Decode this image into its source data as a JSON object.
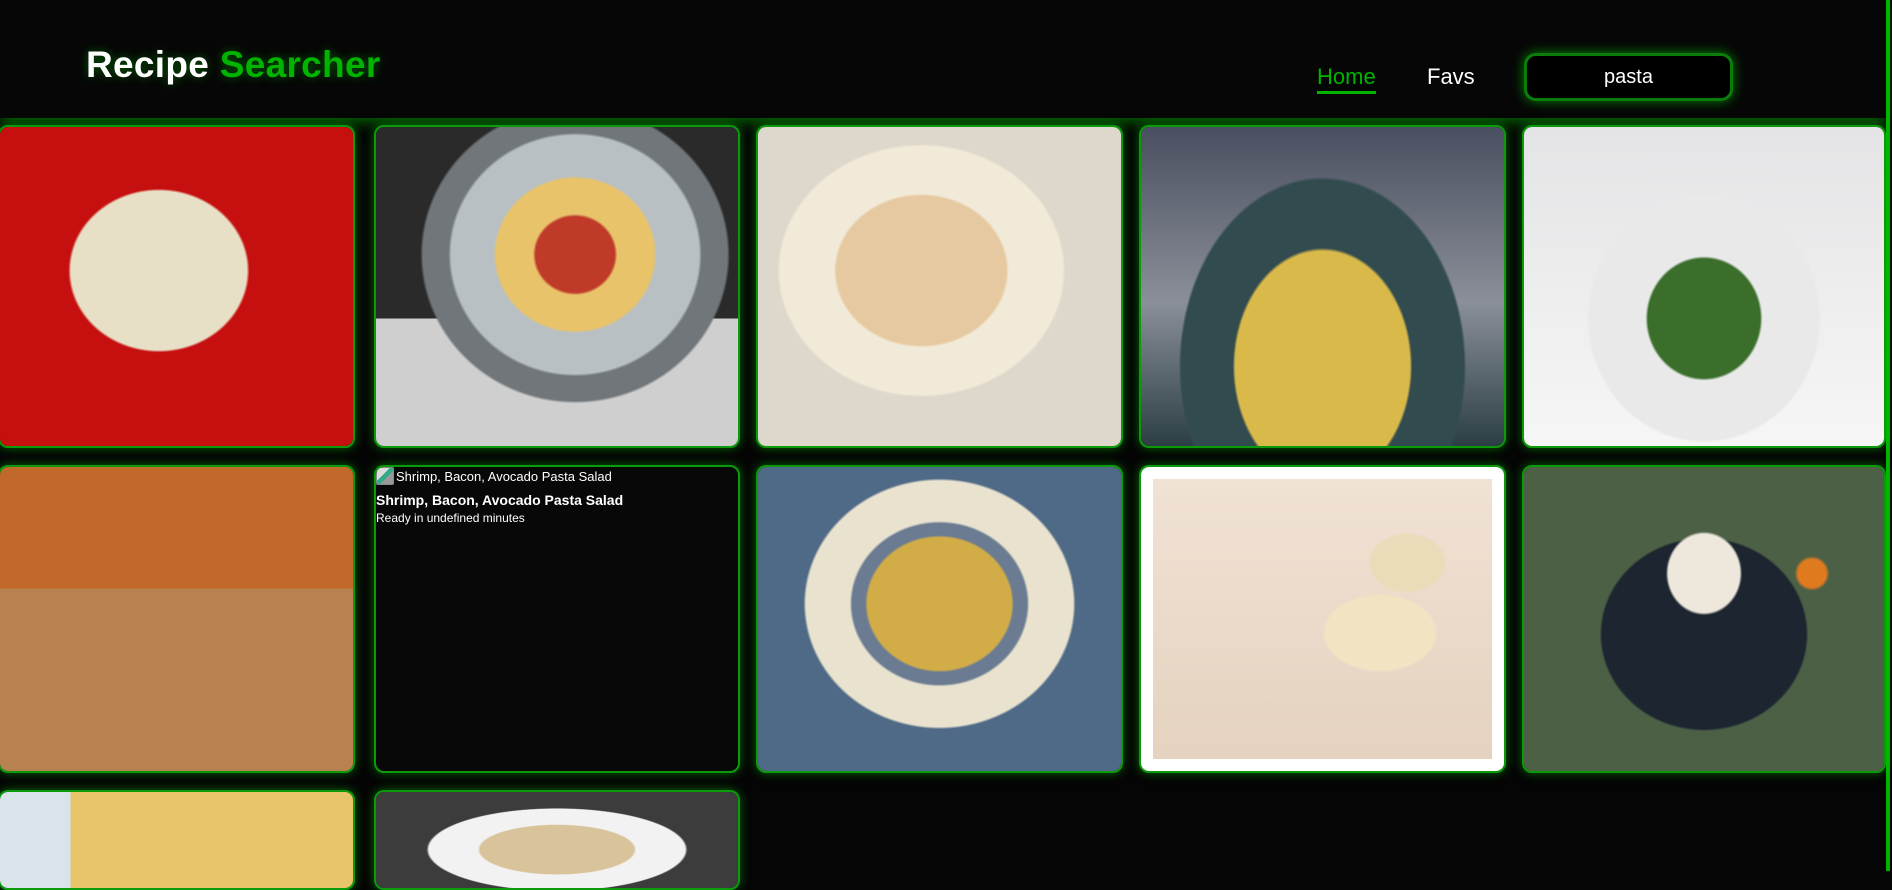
{
  "header": {
    "logo_white": "Recipe",
    "logo_green": "Searcher",
    "nav": {
      "home": "Home",
      "favs": "Favs"
    },
    "search_value": "pasta"
  },
  "colors": {
    "accent": "#00b400",
    "background": "#050505"
  },
  "cards": [
    {
      "kind": "image",
      "icon": "pasta-photo"
    },
    {
      "kind": "image",
      "icon": "pasta-photo"
    },
    {
      "kind": "image",
      "icon": "pasta-photo"
    },
    {
      "kind": "image",
      "icon": "pasta-photo"
    },
    {
      "kind": "image",
      "icon": "pasta-photo"
    },
    {
      "kind": "image",
      "icon": "pasta-photo"
    },
    {
      "kind": "text",
      "alt": "Shrimp, Bacon, Avocado Pasta Salad",
      "title": "Shrimp, Bacon, Avocado Pasta Salad",
      "ready": "Ready in undefined minutes"
    },
    {
      "kind": "image",
      "icon": "pasta-photo"
    },
    {
      "kind": "image",
      "icon": "pasta-photo"
    },
    {
      "kind": "image",
      "icon": "pasta-photo"
    },
    {
      "kind": "image",
      "icon": "pasta-photo"
    },
    {
      "kind": "image",
      "icon": "pasta-photo"
    }
  ]
}
